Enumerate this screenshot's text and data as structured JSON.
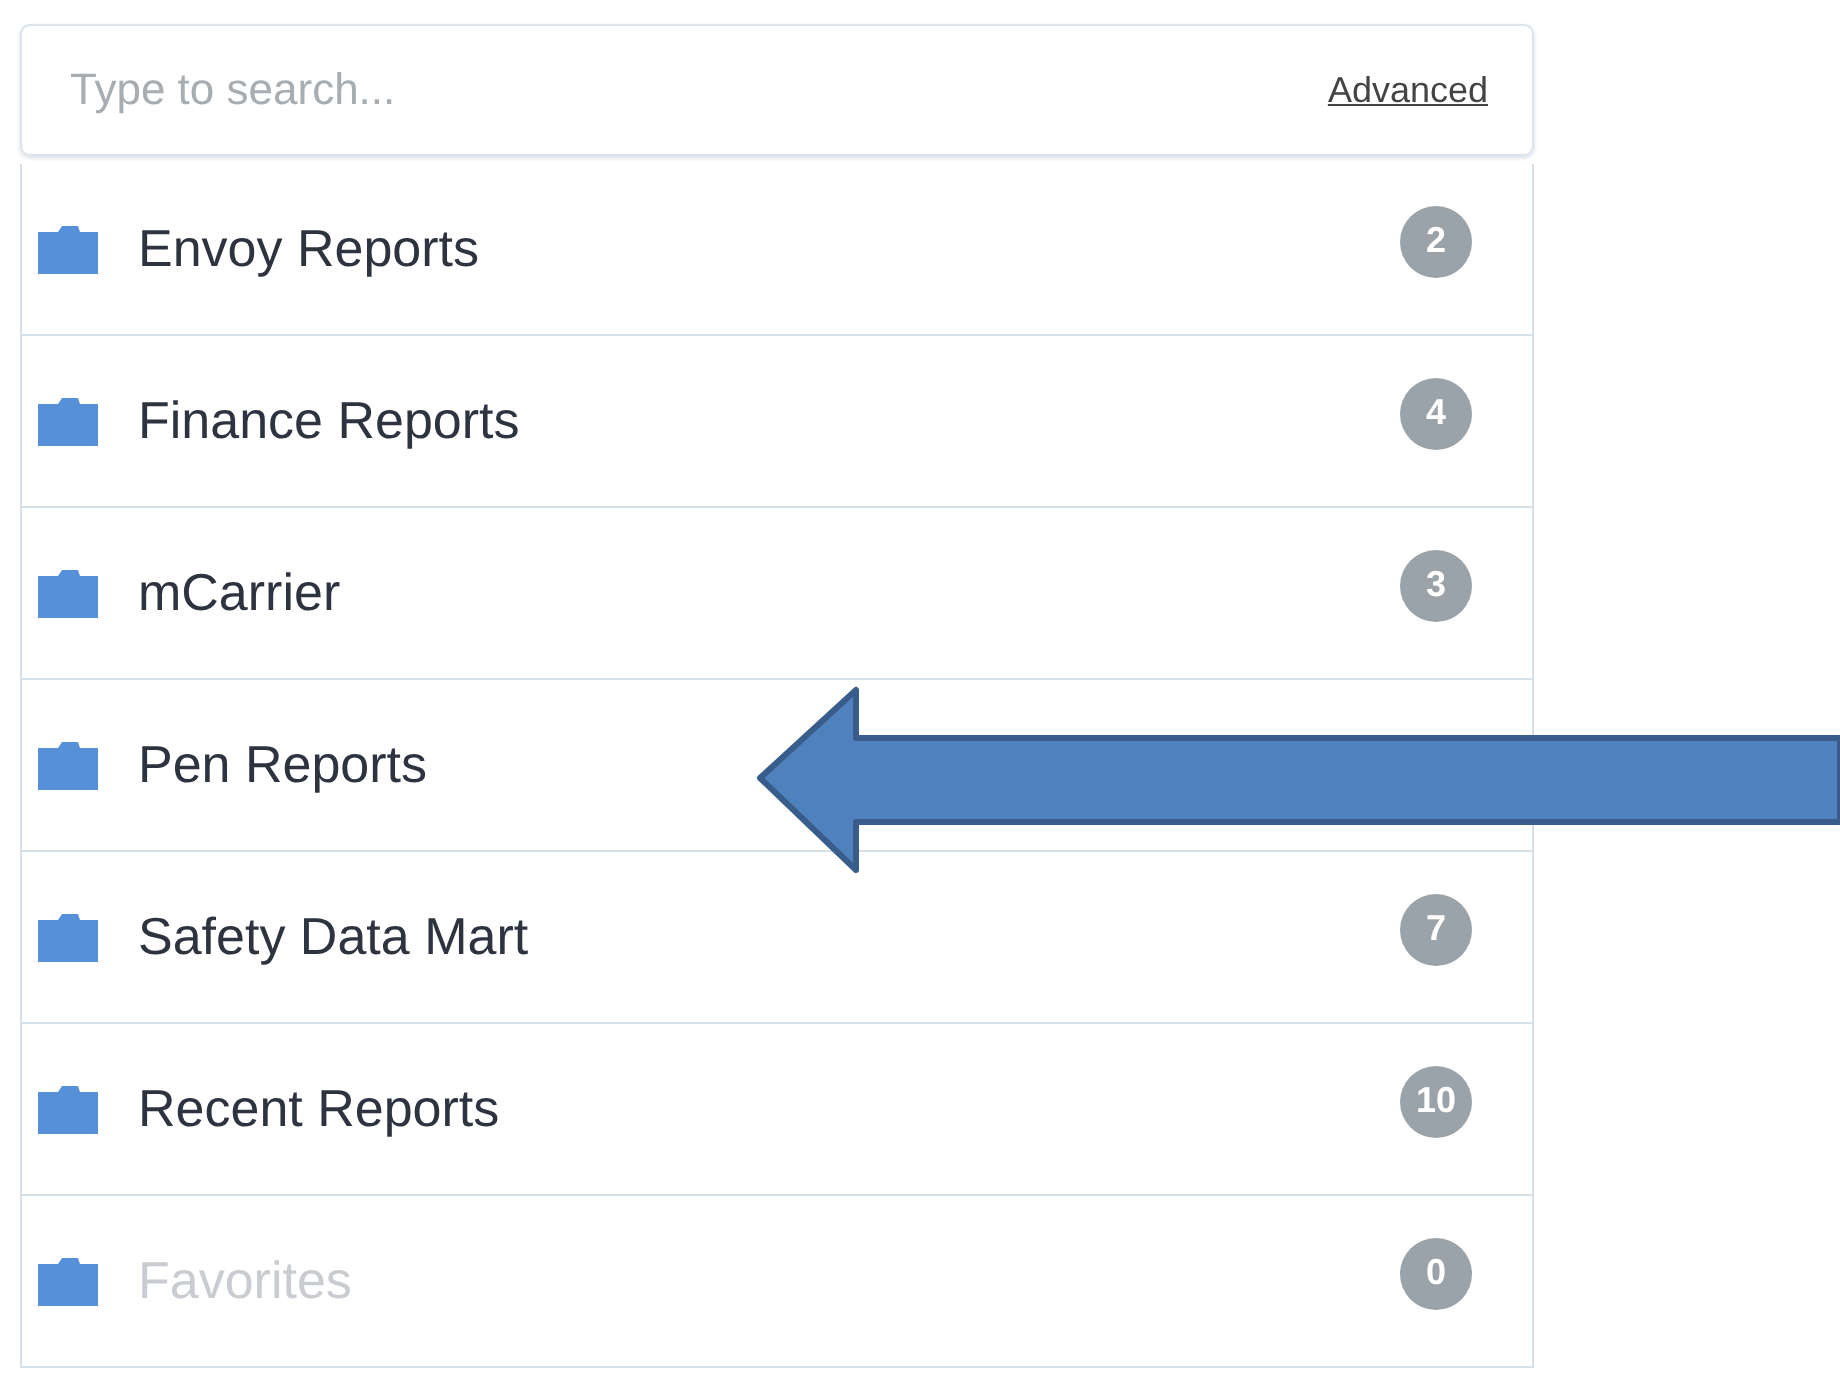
{
  "search": {
    "placeholder": "Type to search...",
    "link": "Advanced"
  },
  "folders": [
    {
      "label": "Envoy Reports",
      "count": "2",
      "disabled": false
    },
    {
      "label": "Finance Reports",
      "count": "4",
      "disabled": false
    },
    {
      "label": "mCarrier",
      "count": "3",
      "disabled": false
    },
    {
      "label": "Pen Reports",
      "disabled": false
    },
    {
      "label": "Safety Data Mart",
      "count": "7",
      "disabled": false
    },
    {
      "label": "Recent Reports",
      "count": "10",
      "disabled": false
    },
    {
      "label": "Favorites",
      "count": "0",
      "disabled": true
    }
  ],
  "callout": {
    "kind": "arrow"
  }
}
